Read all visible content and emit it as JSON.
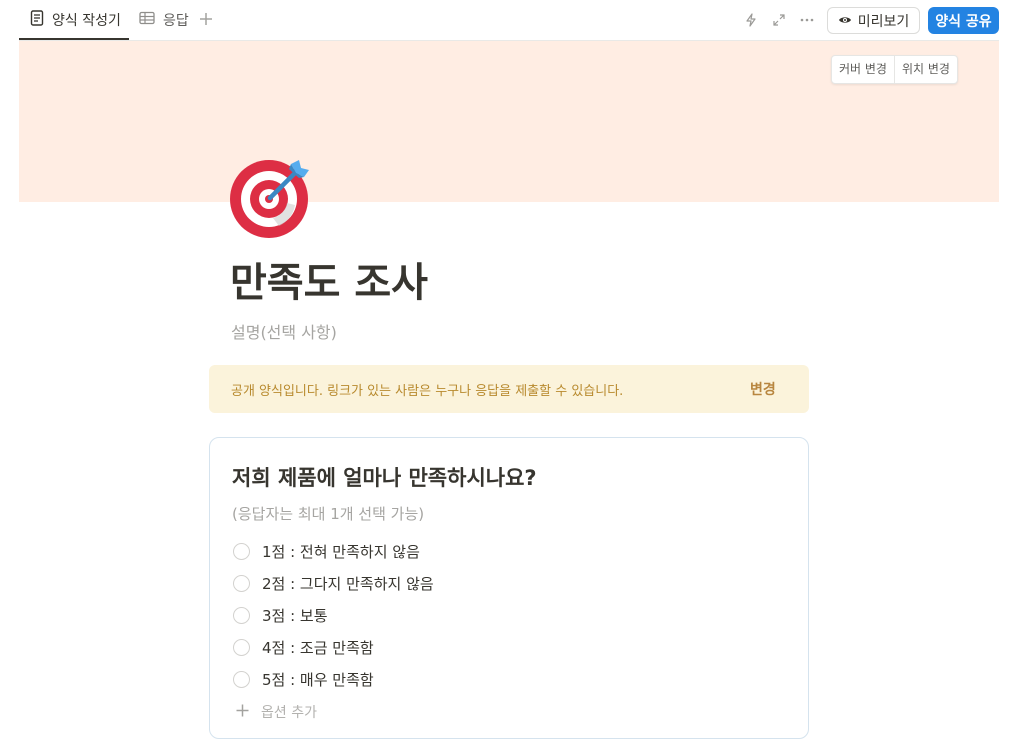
{
  "tabs": [
    {
      "label": "양식 작성기",
      "icon": "document-icon",
      "active": true
    },
    {
      "label": "응답",
      "icon": "table-icon",
      "active": false
    }
  ],
  "topbar": {
    "add_tab_icon": "plus-icon",
    "preview_label": "미리보기",
    "share_label": "양식 공유",
    "accent": "#2383e2"
  },
  "cover": {
    "color": "#ffede3",
    "change_cover": "커버 변경",
    "reposition": "위치 변경"
  },
  "page": {
    "icon": "target-icon",
    "title": "만족도 조사",
    "description_placeholder": "설명(선택 사항)"
  },
  "banner": {
    "text": "공개 양식입니다. 링크가 있는 사람은 누구나 응답을 제출할 수 있습니다.",
    "action": "변경"
  },
  "question": {
    "title": "저희 제품에 얼마나 만족하시나요?",
    "hint": "(응답자는 최대 1개 선택 가능)",
    "options": [
      "1점 : 전혀 만족하지 않음",
      "2점 : 그다지 만족하지 않음",
      "3점 : 보통",
      "4점 : 조금 만족함",
      "5점 : 매우 만족함"
    ],
    "add_option": "옵션 추가"
  }
}
